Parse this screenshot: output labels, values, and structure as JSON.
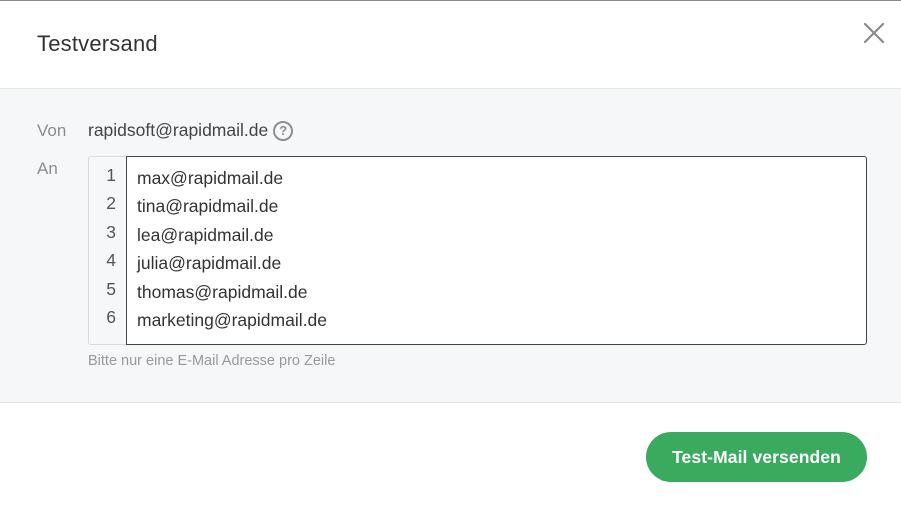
{
  "dialog": {
    "title": "Testversand",
    "close_icon": "close-icon"
  },
  "form": {
    "from_label": "Von",
    "from_address": "rapidsoft@rapidmail.de",
    "help_icon": "question-circle-icon",
    "help_glyph": "?",
    "to_label": "An",
    "recipients": {
      "line_numbers": [
        "1",
        "2",
        "3",
        "4",
        "5",
        "6"
      ],
      "lines": [
        "max@rapidmail.de",
        "tina@rapidmail.de",
        "lea@rapidmail.de",
        "julia@rapidmail.de",
        "thomas@rapidmail.de",
        "marketing@rapidmail.de"
      ]
    },
    "hint": "Bitte nur eine E-Mail Adresse pro Zeile"
  },
  "footer": {
    "submit_label": "Test-Mail versenden"
  },
  "colors": {
    "accent": "#3aaa5e",
    "body_bg": "#f6f7f8"
  }
}
